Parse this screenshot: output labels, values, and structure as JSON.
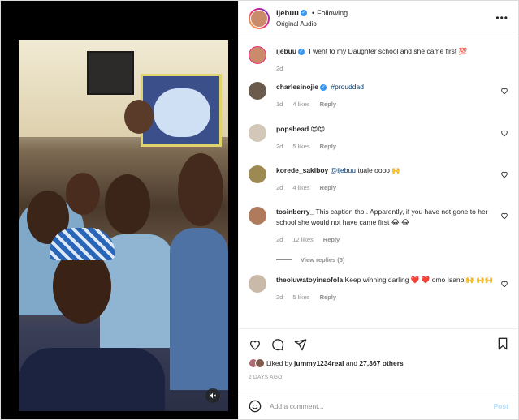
{
  "colors": {
    "verified": "#3897f0",
    "link": "#00376b",
    "muted": "#8e8e8e",
    "post_disabled": "#b2dffc"
  },
  "header": {
    "username": "ijebuu",
    "separator": "•",
    "follow_status": "Following",
    "subtitle": "Original Audio",
    "more_icon": "more-horizontal-icon"
  },
  "caption": {
    "username": "ijebuu",
    "text": "I went to my Daughter school and she came first 💯",
    "time": "2d"
  },
  "comments": [
    {
      "username": "charlesinojie",
      "verified": true,
      "text": "#prouddad",
      "time": "1d",
      "likes": "4 likes",
      "reply": "Reply"
    },
    {
      "username": "popsbead",
      "text": "😍😍",
      "time": "2d",
      "likes": "5 likes",
      "reply": "Reply"
    },
    {
      "username": "korede_sakiboy",
      "mention": "@ijebuu",
      "text": " tuale oooo 🙌",
      "time": "2d",
      "likes": "4 likes",
      "reply": "Reply"
    },
    {
      "username": "tosinberry_",
      "text": " This caption tho.. Apparently, if you have not gone to her school she would not have came first 😂 😂",
      "time": "2d",
      "likes": "12 likes",
      "reply": "Reply",
      "view_replies": "View replies (5)"
    },
    {
      "username": "theoluwatoyinsofola",
      "text": " Keep winning darling ❤️ ❤️ omo Isanbi🙌 🙌🙌",
      "time": "2d",
      "likes": "5 likes",
      "reply": "Reply"
    }
  ],
  "actions": {
    "liked_prefix": "Liked by",
    "liked_user": "jummy1234real",
    "liked_and": "and",
    "liked_count": "27,367 others",
    "date": "2 DAYS AGO"
  },
  "add_comment": {
    "placeholder": "Add a comment...",
    "post_label": "Post"
  }
}
